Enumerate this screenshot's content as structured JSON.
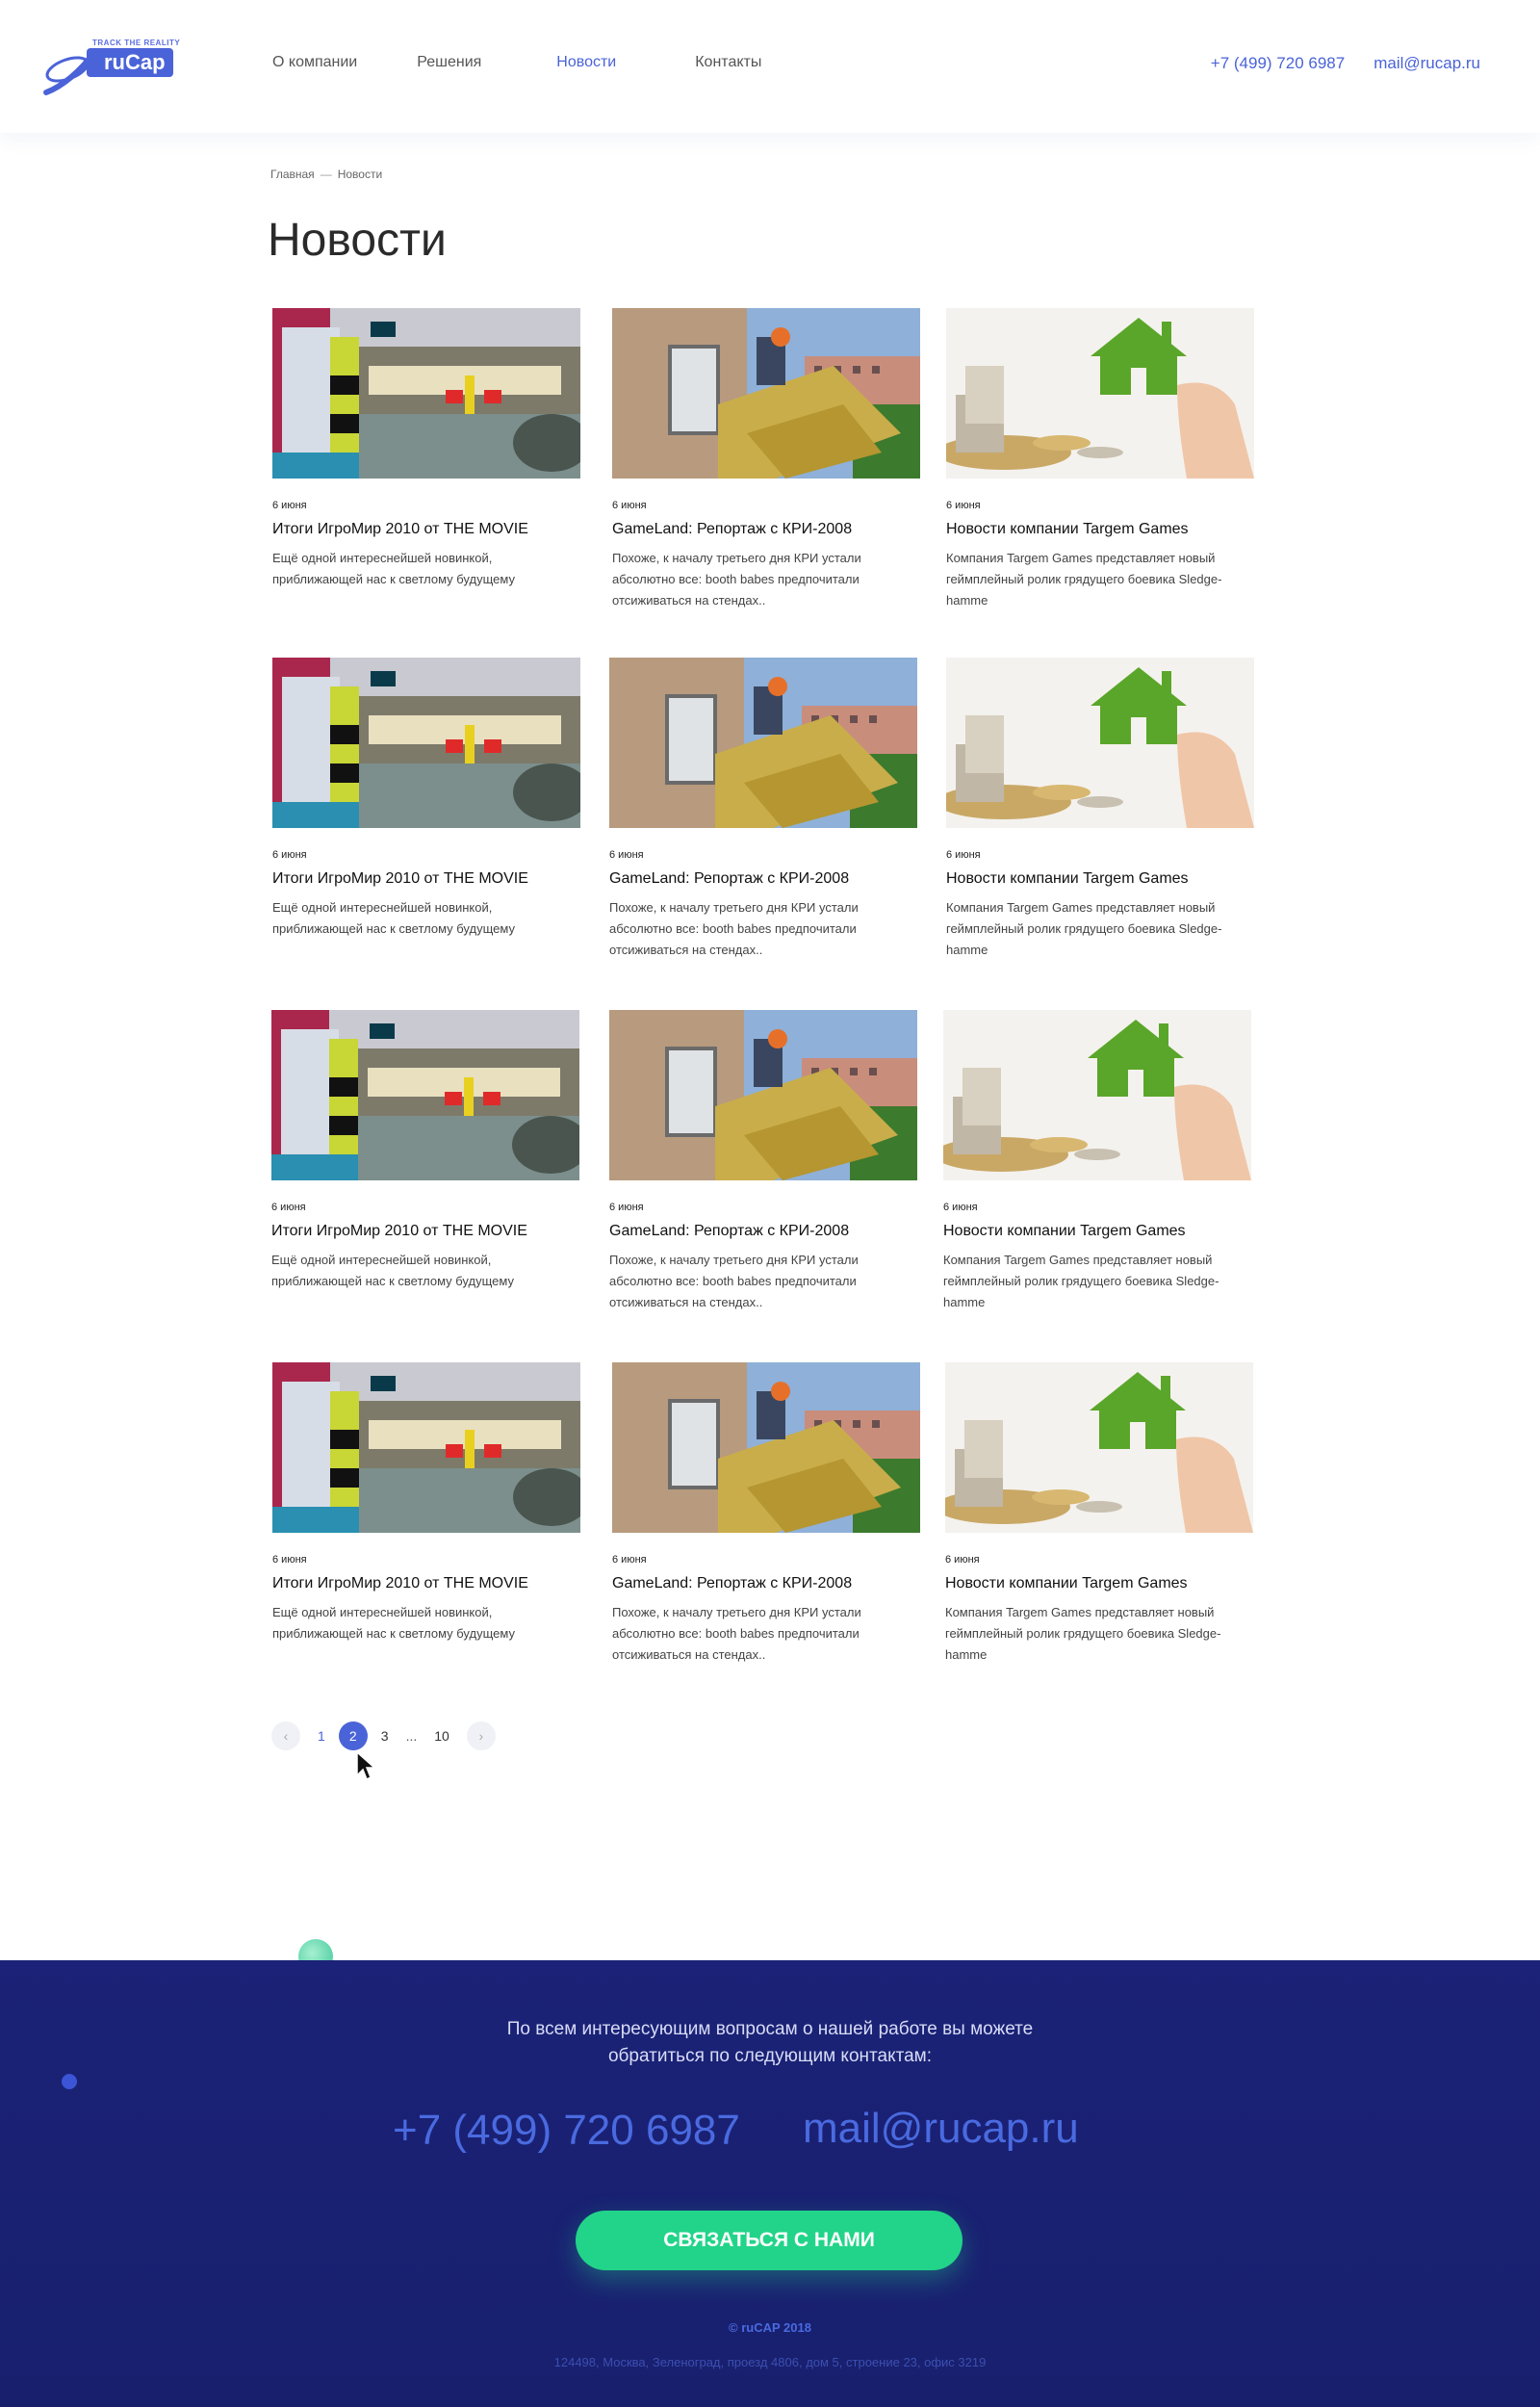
{
  "header": {
    "logo": {
      "text": "ruCap",
      "tagline": "TRACK THE REALITY"
    },
    "nav": [
      "О компании",
      "Решения",
      "Новости",
      "Контакты"
    ],
    "active_nav": "Новости",
    "phone": "+7 (499) 720 6987",
    "email": "mail@rucap.ru"
  },
  "breadcrumb": {
    "home": "Главная",
    "separator": "—",
    "current": "Новости"
  },
  "page_title": "Новости",
  "news": [
    {
      "date": "6 июня",
      "title": "Итоги ИгроМир 2010 от THE MOVIE",
      "desc": "Ещё одной интереснейшей новинкой, приближающей нас к светлому будущему",
      "image": "parking"
    },
    {
      "date": "6 июня",
      "title": "GameLand: Репортаж с КРИ-2008",
      "desc": "Похоже, к началу третьего дня КРИ устали абсолютно все: booth babes предпочитали отсиживаться на стендах..",
      "image": "construction"
    },
    {
      "date": "6 июня",
      "title": "Новости компании Targem Games",
      "desc": "Компания Targem Games представляет новый геймплейный ролик грядущего боевика Sledge-hamme",
      "image": "house-coins"
    }
  ],
  "pagination": {
    "prev": "‹",
    "pages": [
      "1",
      "2",
      "3"
    ],
    "current": "2",
    "dots": "...",
    "last": "10",
    "next": "›"
  },
  "footer": {
    "text_line1": "По всем интересующим вопросам о нашей работе вы можете",
    "text_line2": "обратиться по следующим контактам:",
    "phone": "+7 (499) 720 6987",
    "email": "mail@rucap.ru",
    "cta": "СВЯЗАТЬСЯ С НАМИ",
    "copyright": "© ruCAP 2018",
    "address": "124498, Москва, Зеленоград, проезд 4806, дом 5, строение 23, офис 3219"
  },
  "colors": {
    "accent": "#4a63d8",
    "footer_bg": "#1a237e",
    "cta": "#22d489"
  }
}
